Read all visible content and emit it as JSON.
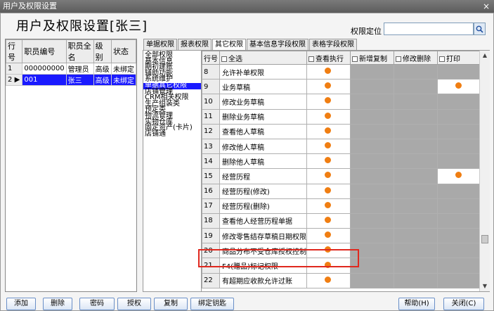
{
  "window": {
    "title": "用户及权限设置",
    "close_label": "×"
  },
  "heading": "用户及权限设置[张三]",
  "search": {
    "label": "权限定位",
    "value": ""
  },
  "users": {
    "headers": [
      "行号",
      "职员编号",
      "职员全名",
      "级别",
      "状态"
    ],
    "rows": [
      {
        "num": "1",
        "code": "000000000",
        "name": "管理员",
        "level": "高级",
        "status": "未绑定"
      },
      {
        "num": "2",
        "code": "001",
        "name": "张三",
        "level": "高级",
        "status": "未绑定"
      }
    ]
  },
  "tabs": [
    "单据权限",
    "报表权限",
    "其它权限",
    "基本信息字段权限",
    "表格字段权限"
  ],
  "tree": [
    "全部权限",
    "基本信息",
    "期初建账",
    "辅助功能",
    "系统维护",
    "单据其它权限",
    "店铺管理",
    "CRM相关权限",
    "生产组装类",
    "预定类",
    "物流管理",
    "实物仓库",
    "固定资产(卡片)",
    "店铺通"
  ],
  "grid": {
    "headers": [
      "行号",
      "全选",
      "查看执行",
      "新增复制",
      "修改删除",
      "打印"
    ],
    "rows": [
      {
        "num": "8",
        "name": "允许补单权限",
        "view": true,
        "print": false
      },
      {
        "num": "9",
        "name": "业务草稿",
        "view": true,
        "print": true
      },
      {
        "num": "10",
        "name": "修改业务草稿",
        "view": true,
        "print": false
      },
      {
        "num": "11",
        "name": "删除业务草稿",
        "view": true,
        "print": false
      },
      {
        "num": "12",
        "name": "查看他人草稿",
        "view": true,
        "print": false
      },
      {
        "num": "13",
        "name": "修改他人草稿",
        "view": true,
        "print": false
      },
      {
        "num": "14",
        "name": "删除他人草稿",
        "view": true,
        "print": false
      },
      {
        "num": "15",
        "name": "经营历程",
        "view": true,
        "print": true
      },
      {
        "num": "16",
        "name": "经营历程(修改)",
        "view": true,
        "print": false
      },
      {
        "num": "17",
        "name": "经营历程(删除)",
        "view": true,
        "print": false
      },
      {
        "num": "18",
        "name": "查看他人经营历程单据",
        "view": true,
        "print": false
      },
      {
        "num": "19",
        "name": "修改零售结存草稿日期权限",
        "view": true,
        "print": false
      },
      {
        "num": "20",
        "name": "商品分布不受仓库授权控制",
        "view": true,
        "print": false
      },
      {
        "num": "21",
        "name": "F4(赠品)标记权限",
        "view": true,
        "print": false
      },
      {
        "num": "22",
        "name": "有超期应收款允许过账",
        "view": true,
        "print": false
      }
    ]
  },
  "buttons": [
    "添加",
    "删除",
    "密码",
    "授权",
    "复制",
    "绑定钥匙",
    "帮助(H)",
    "关闭(C)"
  ],
  "colors": {
    "dot": "#f07e12",
    "selection": "#1a1aff",
    "highlight": "#e0281e",
    "disabled_cell": "#a9a9a9"
  }
}
